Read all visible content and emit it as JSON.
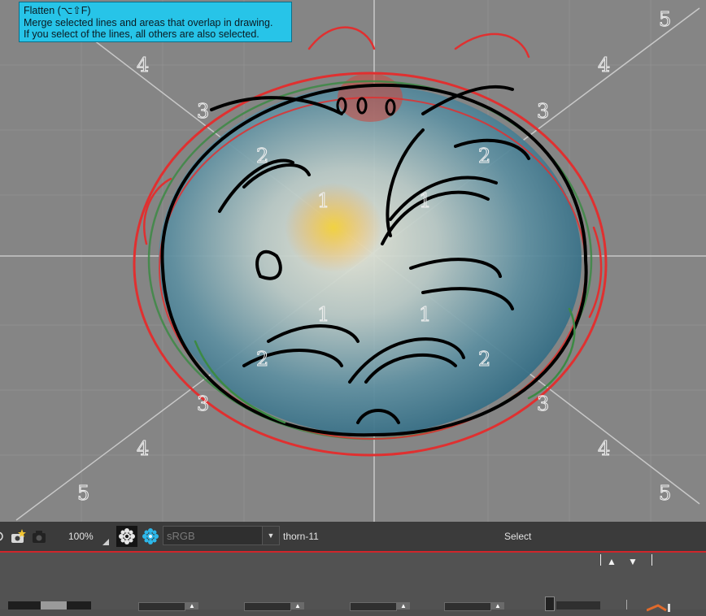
{
  "tooltip": {
    "title": "Flatten (⌥⇧F)",
    "line1": "Merge selected lines and areas that overlap in drawing.",
    "line2": "If you select of the lines, all others are also selected."
  },
  "guides": {
    "labels": [
      "1",
      "1",
      "1",
      "1",
      "2",
      "2",
      "2",
      "2",
      "3",
      "3",
      "3",
      "3",
      "4",
      "4",
      "4",
      "4",
      "5",
      "5",
      "5"
    ]
  },
  "status_bar": {
    "zoom": "100%",
    "color_profile": "sRGB",
    "drawing_name": "thorn-11",
    "tool_mode": "Select",
    "icons": [
      "camera-star-icon",
      "camera-icon",
      "gear-flower-icon",
      "blue-flower-icon",
      "dropdown-arrow-icon"
    ]
  },
  "bottom_panel": {
    "nav": [
      "▲",
      "▼"
    ]
  },
  "colors": {
    "canvas": "#858585",
    "status_bar": "#3b3b3b",
    "accent_red": "#d0262b",
    "tooltip": "#27c4e8"
  }
}
